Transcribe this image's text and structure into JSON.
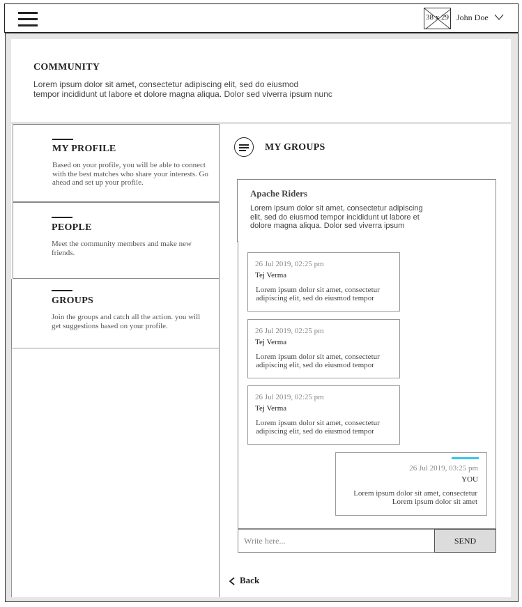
{
  "header": {
    "avatar_placeholder": "38 x 29",
    "user_name": "John Doe",
    "icons": {
      "menu": "hamburger-icon",
      "avatar": "image-placeholder-icon",
      "dropdown": "chevron-down-icon"
    }
  },
  "community": {
    "title": "COMMUNITY",
    "description_line1": "Lorem ipsum dolor sit amet, consectetur adipiscing elit, sed do eiusmod",
    "description_line2": "tempor incididunt ut labore et dolore magna aliqua. Dolor sed viverra ipsum nunc"
  },
  "nav": [
    {
      "title": "MY PROFILE",
      "description": "Based on your profile, you will  be able to connect with the best matches who share your interests. Go ahead and set up your profile."
    },
    {
      "title": "PEOPLE",
      "description": "Meet the community members and make new friends."
    },
    {
      "title": "GROUPS",
      "description": "Join the groups and catch all the action. you will get suggestions based on your profile."
    }
  ],
  "my_groups": {
    "title": "MY GROUPS",
    "icon": "menu-circle-icon",
    "group": {
      "name": "Apache Riders",
      "description": "Lorem ipsum dolor sit amet, consectetur adipiscing elit, sed do eiusmod tempor incididunt ut labore et dolore magna aliqua. Dolor sed viverra ipsum"
    },
    "messages": [
      {
        "time": "26 Jul 2019, 02:25 pm",
        "author": "Tej Verma",
        "text": "Lorem ipsum dolor sit amet, consectetur adipiscing elit, sed do eiusmod tempor"
      },
      {
        "time": "26 Jul 2019, 02:25 pm",
        "author": "Tej Verma",
        "text": "Lorem ipsum dolor sit amet, consectetur adipiscing elit, sed do eiusmod tempor"
      },
      {
        "time": "26 Jul 2019, 02:25 pm",
        "author": "Tej Verma",
        "text": "Lorem ipsum dolor sit amet, consectetur adipiscing elit, sed do eiusmod tempor"
      }
    ],
    "own_message": {
      "time": "26 Jul 2019, 03:25 pm",
      "author": "YOU",
      "line1": "Lorem ipsum dolor sit amet, consectetur",
      "line2": "Lorem ipsum dolor sit amet",
      "accent_color": "#38c6e8"
    },
    "input_placeholder": "Write here...",
    "send_label": "SEND"
  },
  "back_label": "Back",
  "back_icon": "chevron-left-icon"
}
